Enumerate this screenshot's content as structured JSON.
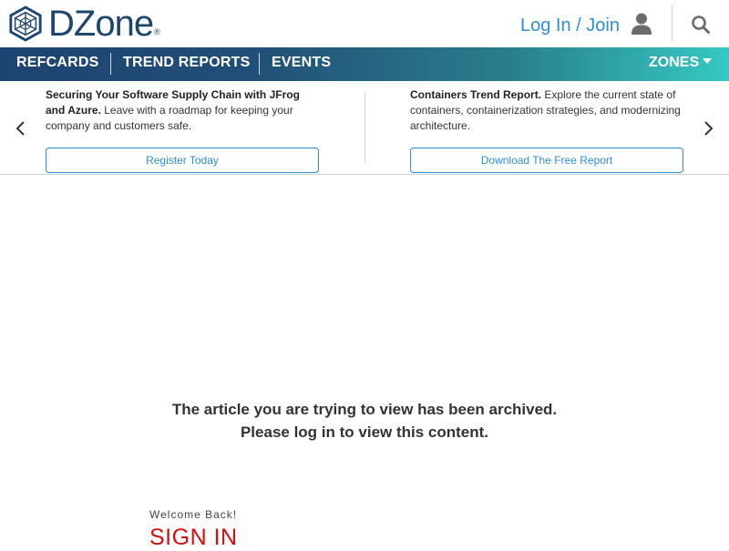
{
  "header": {
    "logo_text": "DZone",
    "logo_mark": "®",
    "login_label": "Log In / Join",
    "user_icon": "user-icon",
    "search_icon": "search-icon"
  },
  "nav": {
    "items": [
      {
        "label": "REFCARDS"
      },
      {
        "label": "TREND REPORTS"
      },
      {
        "label": "EVENTS"
      }
    ],
    "zones_label": "ZONES"
  },
  "carousel": {
    "promos": [
      {
        "title": "Securing Your Software Supply Chain with JFrog and Azure.",
        "body": " Leave with a roadmap for keeping your company and customers safe.",
        "button": "Register Today"
      },
      {
        "title": "Containers Trend Report.",
        "body": " Explore the current state of containers, containerization strategies, and modernizing architecture.",
        "button": "Download The Free Report"
      }
    ]
  },
  "main": {
    "archived_line1": "The article you are trying to view has been archived.",
    "archived_line2": "Please log in to view this content.",
    "welcome": "Welcome Back!",
    "signin_title": "SIGN IN"
  },
  "colors": {
    "brand_navy": "#1d456e",
    "link_blue": "#2d8fd5",
    "signin_red": "#d20f0f",
    "nav_gradient_start": "#1d4470",
    "nav_gradient_end": "#35c9c4"
  }
}
